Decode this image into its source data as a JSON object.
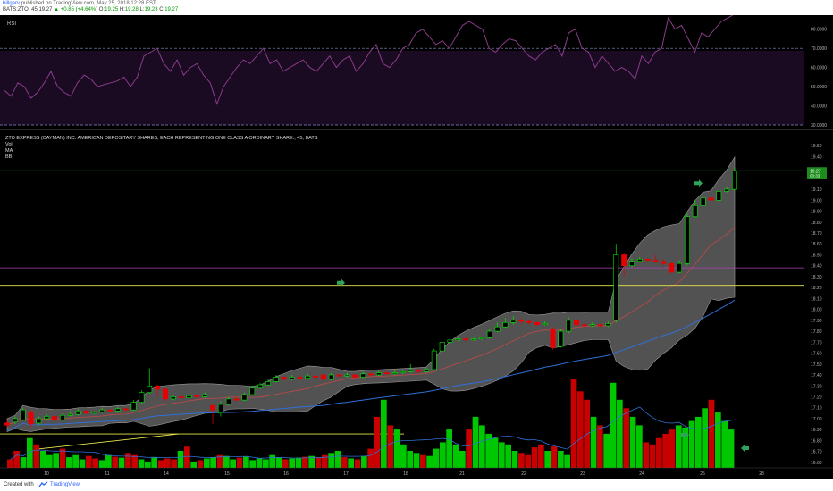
{
  "header": {
    "user": "billgarv",
    "published": "published on TradingView.com, May 25, 2018 12:28 EST",
    "symbol": "BATS:ZTO, 45",
    "price": "19.27",
    "change": "▲ +0.85 (+4.64%)",
    "o_label": "O:",
    "o": "19.25",
    "h_label": "H:",
    "h": "19.28",
    "l_label": "L:",
    "l": "19.23",
    "c_label": "C:",
    "c": "19.27"
  },
  "footer": {
    "created": "Created with",
    "brand": "TradingView"
  },
  "colors": {
    "background": "#000000",
    "up": "#00e600",
    "down": "#e60000",
    "volume_up": "#00c800",
    "volume_down": "#c80000",
    "rsi": "#8a3c8a",
    "ma": "#2f6fd6",
    "bb_fill": "#6d6d6d",
    "bb_basis": "#c04848",
    "support": "#e6e64a",
    "resistance": "#2aa02a",
    "mid_line": "#b040b0"
  },
  "chart_data": [
    {
      "type": "line",
      "title": "RSI",
      "series": [
        {
          "values": [
            48,
            45,
            52,
            50,
            44,
            47,
            52,
            58,
            50,
            47,
            45,
            52,
            56,
            54,
            50,
            51,
            52,
            53,
            55,
            50,
            55,
            66,
            68,
            70,
            62,
            58,
            64,
            56,
            60,
            62,
            56,
            52,
            41,
            50,
            55,
            60,
            64,
            62,
            66,
            70,
            62,
            64,
            58,
            60,
            62,
            64,
            60,
            58,
            62,
            66,
            60,
            64,
            66,
            58,
            62,
            68,
            72,
            62,
            60,
            64,
            70,
            72,
            78,
            80,
            76,
            72,
            74,
            70,
            76,
            82,
            84,
            82,
            80,
            70,
            68,
            72,
            75,
            74,
            70,
            66,
            64,
            68,
            70,
            72,
            66,
            78,
            80,
            70,
            68,
            60,
            66,
            62,
            58,
            60,
            58,
            54,
            66,
            62,
            68,
            70,
            86,
            80,
            82,
            75,
            68,
            78,
            76,
            80,
            84,
            86,
            88
          ]
        }
      ],
      "ylim": [
        30,
        85
      ],
      "tick_labels": [
        "80.0000",
        "70.0000",
        "60.0000",
        "50.0000",
        "40.0000",
        "30.0000"
      ],
      "levels": [
        70,
        30
      ]
    },
    {
      "type": "candlestick",
      "title": "ZTO EXPRESS (CAYMAN) INC. AMERICAN DEPOSITARY SHARES, EACH REPRESENTING ONE CLASS A ORDINARY SHARE., 45, BATS",
      "legend": [
        "Vol",
        "MA",
        "BB"
      ],
      "x_tick_labels": [
        "10",
        "11",
        "14",
        "15",
        "16",
        "17",
        "18",
        "21",
        "22",
        "23",
        "24",
        "25",
        "28"
      ],
      "y_tick_labels": [
        "19.50",
        "19.40",
        "19.27",
        "19.10",
        "19.00",
        "18.90",
        "18.80",
        "18.70",
        "18.60",
        "18.50",
        "18.40",
        "18.30",
        "18.20",
        "18.10",
        "18.00",
        "17.90",
        "17.80",
        "17.70",
        "17.60",
        "17.50",
        "17.40",
        "17.30",
        "17.20",
        "17.10",
        "17.00",
        "16.90",
        "16.80",
        "16.70",
        "16.60"
      ],
      "last_price_label": "19.27",
      "last_price_sub": "00:33",
      "ylim": [
        16.55,
        19.55
      ],
      "candles": [
        [
          16.96,
          16.94,
          16.98,
          16.92
        ],
        [
          16.97,
          17.0,
          17.02,
          16.95
        ],
        [
          16.99,
          17.08,
          17.1,
          16.98
        ],
        [
          17.06,
          16.95,
          17.08,
          16.92
        ],
        [
          16.96,
          17.0,
          17.02,
          16.94
        ],
        [
          17.0,
          17.02,
          17.04,
          16.99
        ],
        [
          17.02,
          16.99,
          17.03,
          16.98
        ],
        [
          16.99,
          17.03,
          17.05,
          16.98
        ],
        [
          17.03,
          17.04,
          17.07,
          17.02
        ],
        [
          17.04,
          17.07,
          17.09,
          17.03
        ],
        [
          17.07,
          17.05,
          17.08,
          17.04
        ],
        [
          17.05,
          17.06,
          17.07,
          17.04
        ],
        [
          17.06,
          17.08,
          17.1,
          17.05
        ],
        [
          17.08,
          17.07,
          17.09,
          17.06
        ],
        [
          17.07,
          17.09,
          17.11,
          17.06
        ],
        [
          17.09,
          17.08,
          17.1,
          17.07
        ],
        [
          17.08,
          17.15,
          17.17,
          17.07
        ],
        [
          17.15,
          17.24,
          17.26,
          17.13
        ],
        [
          17.24,
          17.3,
          17.46,
          17.23
        ],
        [
          17.3,
          17.27,
          17.31,
          17.2
        ],
        [
          17.27,
          17.18,
          17.28,
          17.16
        ],
        [
          17.18,
          17.2,
          17.21,
          17.17
        ],
        [
          17.2,
          17.19,
          17.22,
          17.18
        ],
        [
          17.19,
          17.21,
          17.23,
          17.18
        ],
        [
          17.21,
          17.2,
          17.22,
          17.19
        ],
        [
          17.2,
          17.22,
          17.24,
          17.19
        ],
        [
          17.12,
          17.08,
          17.14,
          16.95
        ],
        [
          17.05,
          17.13,
          17.16,
          17.02
        ],
        [
          17.13,
          17.18,
          17.2,
          17.12
        ],
        [
          17.18,
          17.17,
          17.2,
          17.16
        ],
        [
          17.17,
          17.22,
          17.24,
          17.16
        ],
        [
          17.22,
          17.28,
          17.3,
          17.21
        ],
        [
          17.28,
          17.31,
          17.33,
          17.27
        ],
        [
          17.31,
          17.34,
          17.36,
          17.3
        ],
        [
          17.34,
          17.38,
          17.4,
          17.33
        ],
        [
          17.38,
          17.36,
          17.39,
          17.35
        ],
        [
          17.36,
          17.38,
          17.4,
          17.35
        ],
        [
          17.38,
          17.37,
          17.39,
          17.36
        ],
        [
          17.37,
          17.39,
          17.41,
          17.36
        ],
        [
          17.39,
          17.38,
          17.4,
          17.37
        ],
        [
          17.4,
          17.36,
          17.41,
          17.35
        ],
        [
          17.36,
          17.4,
          17.42,
          17.35
        ],
        [
          17.4,
          17.39,
          17.41,
          17.38
        ],
        [
          17.39,
          17.4,
          17.42,
          17.38
        ],
        [
          17.4,
          17.38,
          17.41,
          17.37
        ],
        [
          17.38,
          17.41,
          17.43,
          17.37
        ],
        [
          17.41,
          17.4,
          17.42,
          17.39
        ],
        [
          17.4,
          17.42,
          17.44,
          17.39
        ],
        [
          17.42,
          17.41,
          17.43,
          17.4
        ],
        [
          17.41,
          17.42,
          17.44,
          17.4
        ],
        [
          17.42,
          17.43,
          17.45,
          17.41
        ],
        [
          17.43,
          17.44,
          17.5,
          17.42
        ],
        [
          17.44,
          17.43,
          17.46,
          17.42
        ],
        [
          17.43,
          17.45,
          17.47,
          17.42
        ],
        [
          17.45,
          17.62,
          17.64,
          17.44
        ],
        [
          17.62,
          17.7,
          17.76,
          17.6
        ],
        [
          17.7,
          17.72,
          17.74,
          17.69
        ],
        [
          17.72,
          17.73,
          17.74,
          17.71
        ],
        [
          17.73,
          17.72,
          17.74,
          17.71
        ],
        [
          17.72,
          17.73,
          17.74,
          17.71
        ],
        [
          17.73,
          17.74,
          17.75,
          17.72
        ],
        [
          17.74,
          17.8,
          17.82,
          17.73
        ],
        [
          17.8,
          17.84,
          17.88,
          17.79
        ],
        [
          17.84,
          17.88,
          17.92,
          17.83
        ],
        [
          17.88,
          17.9,
          17.94,
          17.86
        ],
        [
          17.9,
          17.89,
          17.92,
          17.87
        ],
        [
          17.89,
          17.88,
          17.9,
          17.86
        ],
        [
          17.88,
          17.86,
          17.89,
          17.85
        ],
        [
          17.86,
          17.87,
          17.89,
          17.85
        ],
        [
          17.82,
          17.65,
          17.84,
          17.63
        ],
        [
          17.66,
          17.8,
          17.82,
          17.65
        ],
        [
          17.8,
          17.9,
          17.93,
          17.78
        ],
        [
          17.9,
          17.86,
          17.91,
          17.85
        ],
        [
          17.86,
          17.85,
          17.87,
          17.84
        ],
        [
          17.85,
          17.86,
          17.88,
          17.84
        ],
        [
          17.86,
          17.85,
          17.87,
          17.84
        ],
        [
          17.85,
          17.87,
          17.89,
          17.84
        ],
        [
          17.9,
          18.5,
          18.6,
          17.88
        ],
        [
          18.5,
          18.4,
          18.52,
          18.3
        ],
        [
          18.4,
          18.44,
          18.47,
          18.38
        ],
        [
          18.44,
          18.46,
          18.48,
          18.43
        ],
        [
          18.46,
          18.45,
          18.47,
          18.44
        ],
        [
          18.45,
          18.44,
          18.5,
          18.43
        ],
        [
          18.44,
          18.42,
          18.46,
          18.4
        ],
        [
          18.42,
          18.34,
          18.43,
          18.33
        ],
        [
          18.34,
          18.42,
          18.45,
          18.33
        ],
        [
          18.42,
          18.85,
          18.88,
          18.4
        ],
        [
          18.85,
          18.95,
          19.0,
          18.84
        ],
        [
          18.95,
          19.02,
          19.05,
          18.94
        ],
        [
          19.02,
          19.0,
          19.04,
          18.98
        ],
        [
          19.0,
          19.08,
          19.1,
          18.99
        ],
        [
          19.08,
          19.1,
          19.12,
          19.07
        ],
        [
          19.1,
          19.27,
          19.3,
          19.09
        ]
      ],
      "volumes": [
        20,
        40,
        25,
        70,
        55,
        40,
        30,
        35,
        45,
        25,
        30,
        20,
        28,
        22,
        18,
        30,
        26,
        24,
        35,
        30,
        20,
        15,
        25,
        18,
        22,
        20,
        40,
        50,
        15,
        18,
        22,
        25,
        30,
        28,
        20,
        24,
        26,
        18,
        22,
        20,
        30,
        25,
        20,
        22,
        24,
        26,
        28,
        25,
        30,
        35,
        40,
        25,
        22,
        20,
        28,
        45,
        120,
        160,
        100,
        90,
        55,
        40,
        35,
        30,
        28,
        45,
        60,
        90,
        55,
        40,
        90,
        120,
        100,
        80,
        70,
        60,
        55,
        40,
        35,
        30,
        48,
        55,
        40,
        50,
        40,
        30,
        210,
        180,
        160,
        120,
        100,
        80,
        200,
        160,
        140,
        120,
        100,
        60,
        55,
        70,
        80,
        90,
        100,
        95,
        110,
        120,
        140,
        160,
        130,
        110,
        90
      ]
    }
  ]
}
